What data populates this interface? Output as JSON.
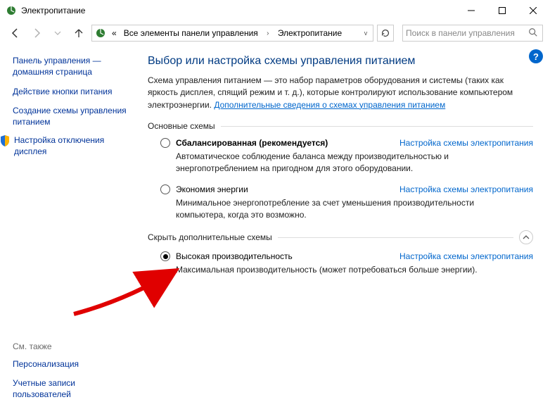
{
  "window": {
    "title": "Электропитание"
  },
  "breadcrumb": {
    "prefix": "«",
    "item1": "Все элементы панели управления",
    "item2": "Электропитание"
  },
  "search": {
    "placeholder": "Поиск в панели управления"
  },
  "sidebar": {
    "home1": "Панель управления —",
    "home2": "домашняя страница",
    "link1": "Действие кнопки питания",
    "link2_a": "Создание схемы управления",
    "link2_b": "питанием",
    "link3_a": "Настройка отключения",
    "link3_b": "дисплея",
    "see_also": "См. также",
    "foot1": "Персонализация",
    "foot2_a": "Учетные записи",
    "foot2_b": "пользователей"
  },
  "main": {
    "title": "Выбор или настройка схемы управления питанием",
    "desc_pre": "Схема управления питанием — это набор параметров оборудования и системы (таких как яркость дисплея, спящий режим и т. д.), которые контролируют использование компьютером электроэнергии. ",
    "desc_link": "Дополнительные сведения о схемах управления питанием",
    "section1": "Основные схемы",
    "section2": "Скрыть дополнительные схемы",
    "change_link": "Настройка схемы электропитания"
  },
  "plans": {
    "balanced": {
      "name": "Сбалансированная (рекомендуется)",
      "desc": "Автоматическое соблюдение баланса между производительностью и энергопотреблением на пригодном для этого оборудовании."
    },
    "saver": {
      "name": "Экономия энергии",
      "desc": "Минимальное энергопотребление за счет уменьшения производительности компьютера, когда это возможно."
    },
    "high": {
      "name": "Высокая производительность",
      "desc": "Максимальная производительность (может потребоваться больше энергии)."
    }
  }
}
